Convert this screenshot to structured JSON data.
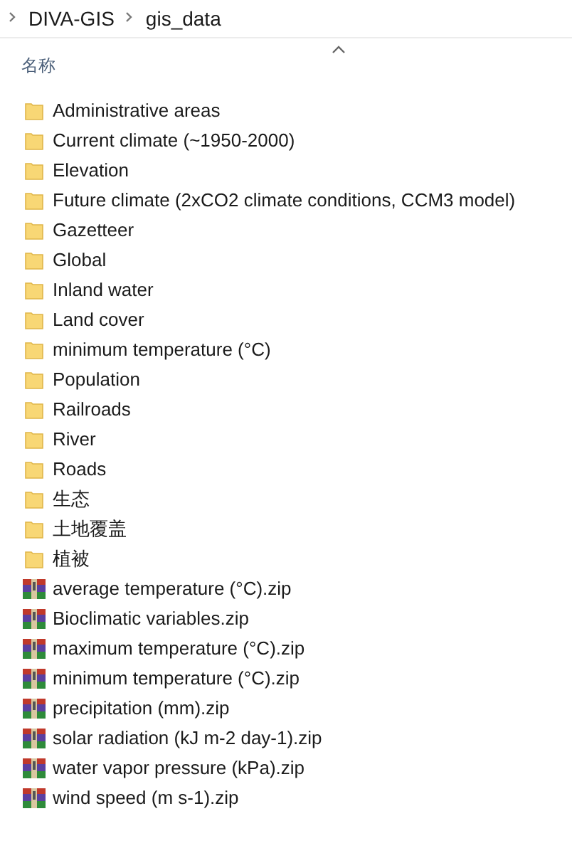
{
  "breadcrumb": [
    "DIVA-GIS",
    "gis_data"
  ],
  "column_header": {
    "label": "名称",
    "sort_ascending": true
  },
  "items": [
    {
      "kind": "folder",
      "name": "Administrative areas"
    },
    {
      "kind": "folder",
      "name": "Current climate (~1950-2000)"
    },
    {
      "kind": "folder",
      "name": "Elevation"
    },
    {
      "kind": "folder",
      "name": "Future climate (2xCO2 climate conditions, CCM3 model)"
    },
    {
      "kind": "folder",
      "name": "Gazetteer"
    },
    {
      "kind": "folder",
      "name": "Global"
    },
    {
      "kind": "folder",
      "name": "Inland water"
    },
    {
      "kind": "folder",
      "name": "Land cover"
    },
    {
      "kind": "folder",
      "name": "minimum temperature (°C)"
    },
    {
      "kind": "folder",
      "name": "Population"
    },
    {
      "kind": "folder",
      "name": "Railroads"
    },
    {
      "kind": "folder",
      "name": "River"
    },
    {
      "kind": "folder",
      "name": "Roads"
    },
    {
      "kind": "folder",
      "name": "生态"
    },
    {
      "kind": "folder",
      "name": "土地覆盖"
    },
    {
      "kind": "folder",
      "name": "植被"
    },
    {
      "kind": "zip",
      "name": "average temperature (°C).zip"
    },
    {
      "kind": "zip",
      "name": "Bioclimatic variables.zip"
    },
    {
      "kind": "zip",
      "name": "maximum temperature (°C).zip"
    },
    {
      "kind": "zip",
      "name": "minimum temperature (°C).zip"
    },
    {
      "kind": "zip",
      "name": "precipitation (mm).zip"
    },
    {
      "kind": "zip",
      "name": "solar radiation (kJ m-2 day-1).zip"
    },
    {
      "kind": "zip",
      "name": "water vapor pressure (kPa).zip"
    },
    {
      "kind": "zip",
      "name": "wind speed (m s-1).zip"
    }
  ]
}
